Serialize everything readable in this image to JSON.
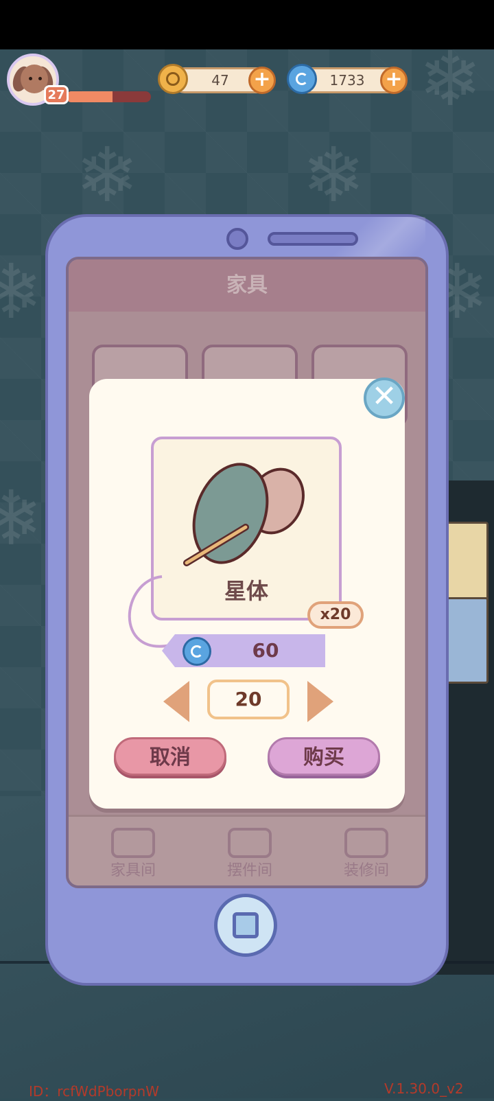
{
  "hud": {
    "level": "27",
    "xp_progress": 0.55,
    "coins": "47",
    "gems": "1733"
  },
  "screen": {
    "title": "家具",
    "nav": [
      "家具间",
      "摆件间",
      "装修间"
    ]
  },
  "purchase_dialog": {
    "item_name": "星体",
    "bundle_badge": "x20",
    "price": "60",
    "quantity": "20",
    "cancel_label": "取消",
    "buy_label": "购买",
    "close_icon": "close-icon"
  },
  "footer": {
    "id_text": "ID：rcfWdPborpnW",
    "version_text": "V.1.30.0_v2"
  },
  "colors": {
    "background": "#34505a",
    "phone": "#8f96d8",
    "dialog": "#fffaf0",
    "cancel": "#e897a6",
    "buy": "#dda6d6"
  }
}
